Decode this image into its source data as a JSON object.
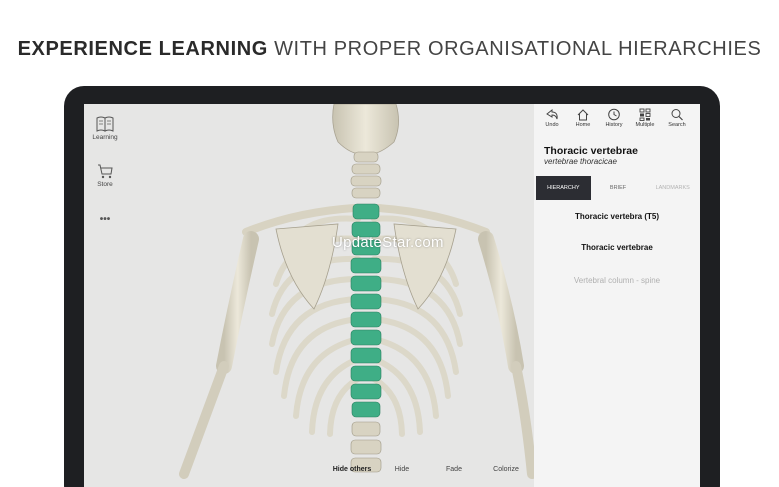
{
  "headline": {
    "strong": "EXPERIENCE LEARNING",
    "light": " WITH PROPER ORGANISATIONAL HIERARCHIES"
  },
  "rail": {
    "items": [
      {
        "label": "Learning",
        "icon": "book-icon"
      },
      {
        "label": "Store",
        "icon": "cart-icon"
      },
      {
        "label": "•••",
        "icon": "more-icon"
      }
    ]
  },
  "toolbar": {
    "buttons": [
      {
        "label": "Undo",
        "icon": "undo-icon"
      },
      {
        "label": "Home",
        "icon": "home-icon"
      },
      {
        "label": "History",
        "icon": "history-icon"
      },
      {
        "label": "Multiple",
        "icon": "multiple-icon"
      },
      {
        "label": "Search",
        "icon": "search-icon"
      }
    ]
  },
  "structure": {
    "title": "Thoracic vertebrae",
    "latin": "vertebrae thoracicae"
  },
  "tabs": [
    {
      "label": "HIERARCHY",
      "active": true
    },
    {
      "label": "BRIEF",
      "active": false
    },
    {
      "label": "LANDMARKS",
      "active": false
    }
  ],
  "hierarchy": [
    "Thoracic vertebra (T5)",
    "Thoracic vertebrae",
    "Vertebral column - spine"
  ],
  "bottom_tools": {
    "hide_others": "Hide others",
    "hide": "Hide",
    "fade": "Fade",
    "colorize": "Colorize"
  },
  "watermark": "UpdateStar.com",
  "colors": {
    "vertebra_highlight": "#3fae86",
    "bone": "#dcd8c9",
    "active_tab": "#2c2d33"
  }
}
